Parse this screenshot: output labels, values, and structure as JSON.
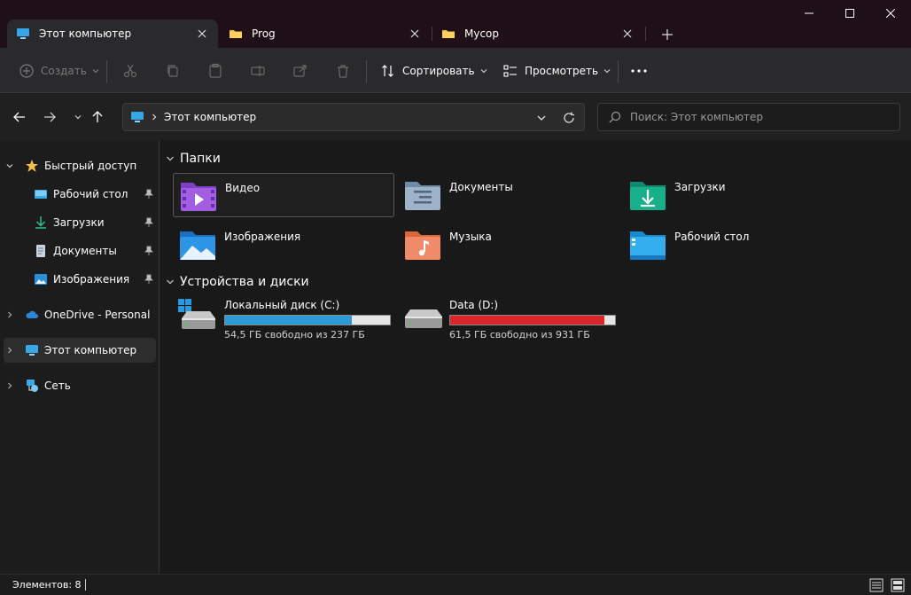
{
  "tabs": [
    {
      "label": "Этот компьютер",
      "active": true
    },
    {
      "label": "Prog",
      "active": false
    },
    {
      "label": "Мусор",
      "active": false
    }
  ],
  "toolbar": {
    "create_label": "Создать",
    "sort_label": "Сортировать",
    "view_label": "Просмотреть"
  },
  "address": {
    "path": "Этот компьютер",
    "search_placeholder": "Поиск: Этот компьютер"
  },
  "sidebar": {
    "items": [
      {
        "label": "Быстрый доступ"
      },
      {
        "label": "Рабочий стол"
      },
      {
        "label": "Загрузки"
      },
      {
        "label": "Документы"
      },
      {
        "label": "Изображения"
      },
      {
        "label": "OneDrive - Personal"
      },
      {
        "label": "Этот компьютер"
      },
      {
        "label": "Сеть"
      }
    ]
  },
  "main": {
    "folders_title": "Папки",
    "folders": [
      {
        "label": "Видео"
      },
      {
        "label": "Документы"
      },
      {
        "label": "Загрузки"
      },
      {
        "label": "Изображения"
      },
      {
        "label": "Музыка"
      },
      {
        "label": "Рабочий стол"
      }
    ],
    "devices_title": "Устройства и диски",
    "drives": [
      {
        "name": "Локальный диск (C:)",
        "free_text": "54,5 ГБ свободно из 237 ГБ",
        "used_fraction": 0.77,
        "bar_color": "#2b9ad6"
      },
      {
        "name": "Data (D:)",
        "free_text": "61,5 ГБ свободно из 931 ГБ",
        "used_fraction": 0.934,
        "bar_color": "#d9262a"
      }
    ]
  },
  "status": {
    "items_text": "Элементов: 8"
  }
}
